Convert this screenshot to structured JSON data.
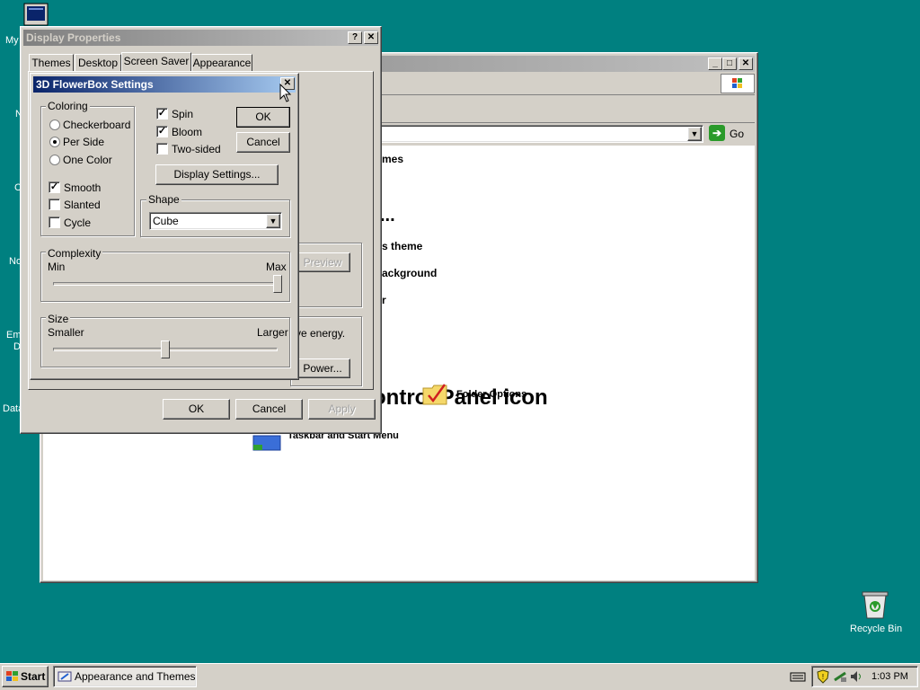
{
  "desktop": {
    "icons": [
      {
        "label": "My"
      },
      {
        "label": "N"
      },
      {
        "label": "C"
      },
      {
        "label": "No"
      },
      {
        "label": "Em"
      },
      {
        "label": "D"
      },
      {
        "label": "Data"
      }
    ],
    "recycle_bin": "Recycle Bin"
  },
  "control_panel": {
    "address_go": "Go",
    "items": {
      "themes_partial": "mes",
      "dots_partial": "...",
      "theme_partial": "s theme",
      "background_partial": "ackground",
      "r_partial": "r",
      "preview_partial": "Preview",
      "t_partial": "t",
      "energy_partial": "ve energy.",
      "power_partial": "Power...",
      "cp_icon_heading": "ontrol Panel icon",
      "folder_options": "Folder Options",
      "taskbar_start": "Taskbar and Start Menu"
    }
  },
  "display_properties": {
    "title": "Display Properties",
    "tabs": [
      "Themes",
      "Desktop",
      "Screen Saver",
      "Appearance"
    ],
    "active_tab": "Screen Saver",
    "ok": "OK",
    "cancel": "Cancel",
    "apply": "Apply"
  },
  "flowerbox": {
    "title": "3D FlowerBox Settings",
    "coloring": {
      "label": "Coloring",
      "options": [
        "Checkerboard",
        "Per Side",
        "One Color"
      ],
      "selected": "Per Side",
      "smooth": "Smooth",
      "slanted": "Slanted",
      "cycle": "Cycle",
      "smooth_checked": true,
      "slanted_checked": false,
      "cycle_checked": false
    },
    "spin": "Spin",
    "bloom": "Bloom",
    "two_sided": "Two-sided",
    "spin_checked": true,
    "bloom_checked": true,
    "two_sided_checked": false,
    "ok": "OK",
    "cancel": "Cancel",
    "display_settings": "Display Settings...",
    "shape": {
      "label": "Shape",
      "value": "Cube"
    },
    "complexity": {
      "label": "Complexity",
      "min": "Min",
      "max": "Max",
      "level": 1.0
    },
    "size": {
      "label": "Size",
      "min": "Smaller",
      "max": "Larger",
      "level": 0.5
    }
  },
  "taskbar": {
    "start": "Start",
    "task": "Appearance and Themes",
    "clock": "1:03 PM"
  }
}
